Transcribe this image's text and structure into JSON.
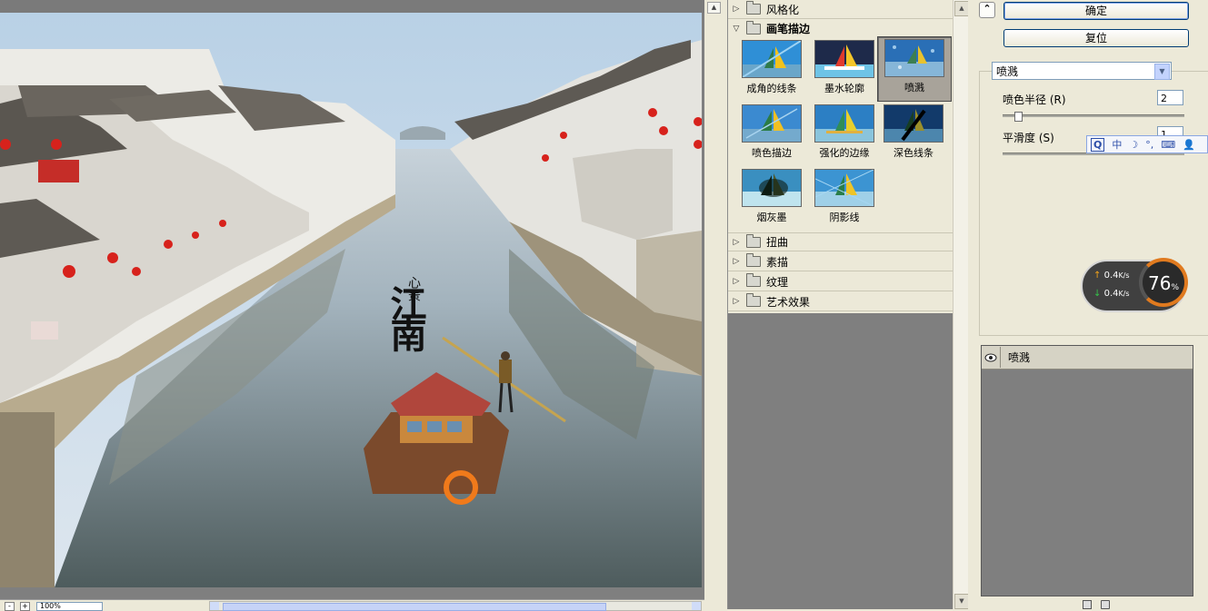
{
  "preview": {
    "zoom_value": "100%",
    "zoom_minus": "-",
    "zoom_plus": "+",
    "calligraphy_title": "江南",
    "calligraphy_subtitle": "心景"
  },
  "gallery": {
    "categories_top": [
      {
        "label": "风格化",
        "expanded": false
      }
    ],
    "open_category": {
      "label": "画笔描边",
      "expanded": true
    },
    "thumbnails": [
      {
        "label": "成角的线条",
        "selected": false
      },
      {
        "label": "墨水轮廓",
        "selected": false
      },
      {
        "label": "喷溅",
        "selected": true
      },
      {
        "label": "喷色描边",
        "selected": false
      },
      {
        "label": "强化的边缘",
        "selected": false
      },
      {
        "label": "深色线条",
        "selected": false
      },
      {
        "label": "烟灰墨",
        "selected": false
      },
      {
        "label": "阴影线",
        "selected": false
      }
    ],
    "categories_bottom": [
      {
        "label": "扭曲"
      },
      {
        "label": "素描"
      },
      {
        "label": "纹理"
      },
      {
        "label": "艺术效果"
      }
    ]
  },
  "settings": {
    "ok_label": "确定",
    "reset_label": "复位",
    "filter_selected": "喷溅",
    "radius_label": "喷色半径 (R)",
    "radius_value": "2",
    "smoothness_label": "平滑度 (S)",
    "smoothness_value": "1",
    "slider_level": 0.08
  },
  "ime_toolbar": {
    "items": [
      "Q",
      "中",
      "☽",
      "°,",
      "⌨",
      "👤"
    ]
  },
  "net_monitor": {
    "upload": "0.4",
    "download": "0.4",
    "unit": "K/s",
    "percent": "76",
    "percent_sign": "%"
  },
  "layers": {
    "items": [
      {
        "label": "喷溅"
      }
    ]
  }
}
